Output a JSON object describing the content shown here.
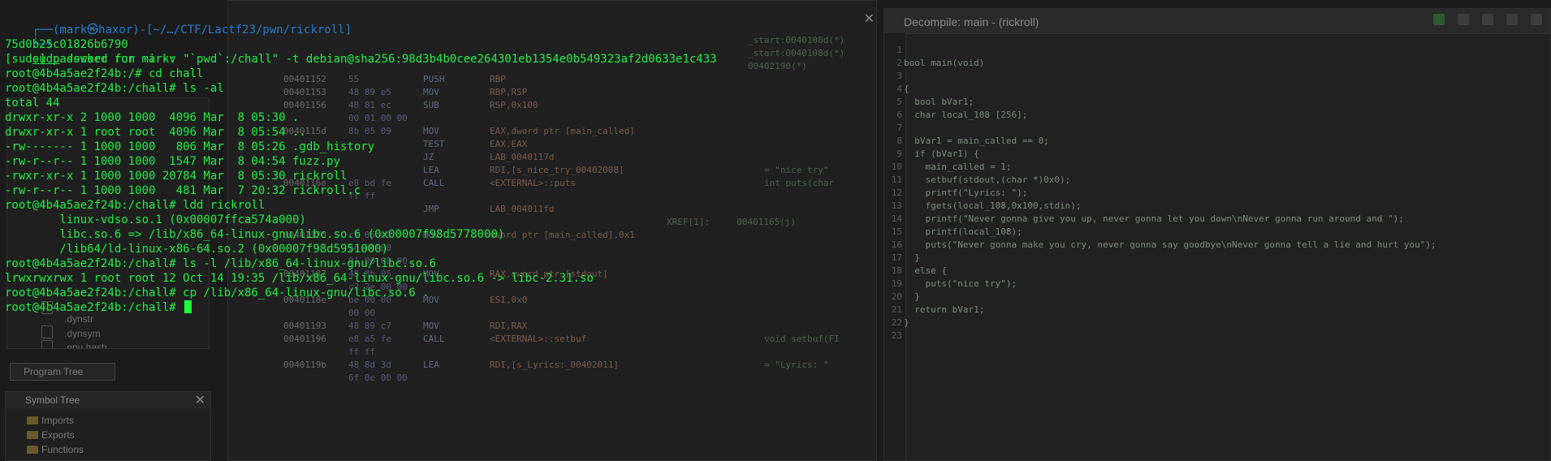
{
  "terminal": {
    "prompt_head": "┌──(mark㉿haxor)-[~/…/CTF/Lactf23/pwn/rickroll]",
    "prompt_tail": "└─$",
    "command_word": "sudo",
    "command_rest": " docker run -i -v \"`pwd`:/chall\" -t debian@sha256:98d3b4b0cee264301eb1354e0b549323af2d0633e1c433",
    "lines": [
      "75d0b25c01826b6790",
      "[sudo] password for mark:",
      "root@4b4a5ae2f24b:/# cd chall",
      "root@4b4a5ae2f24b:/chall# ls -al",
      "total 44",
      "drwxr-xr-x 2 1000 1000  4096 Mar  8 05:30 .",
      "drwxr-xr-x 1 root root  4096 Mar  8 05:54 ..",
      "-rw------- 1 1000 1000   806 Mar  8 05:26 .gdb_history",
      "-rw-r--r-- 1 1000 1000  1547 Mar  8 04:54 fuzz.py",
      "-rwxr-xr-x 1 1000 1000 20784 Mar  8 05:30 rickroll",
      "-rw-r--r-- 1 1000 1000   481 Mar  7 20:32 rickroll.c",
      "root@4b4a5ae2f24b:/chall# ldd rickroll",
      "        linux-vdso.so.1 (0x00007ffca574a000)",
      "        libc.so.6 => /lib/x86_64-linux-gnu/libc.so.6 (0x00007f98d5778000)",
      "        /lib64/ld-linux-x86-64.so.2 (0x00007f98d5951000)",
      "root@4b4a5ae2f24b:/chall# ls -l /lib/x86_64-linux-gnu/libc.so.6",
      "lrwxrwxrwx 1 root root 12 Oct 14 19:35 /lib/x86_64-linux-gnu/libc.so.6 -> libc-2.31.so",
      "root@4b4a5ae2f24b:/chall# cp /lib/x86_64-linux-gnu/libc.so.6 .",
      "root@4b4a5ae2f24b:/chall# "
    ]
  },
  "ghidra": {
    "decompile_title": "Decompile: main - (rickroll)",
    "line_numbers": [
      "1",
      "2",
      "3",
      "4",
      "5",
      "6",
      "7",
      "8",
      "9",
      "10",
      "11",
      "12",
      "13",
      "14",
      "15",
      "16",
      "17",
      "18",
      "19",
      "20",
      "21",
      "22",
      "23"
    ],
    "code_lines": [
      "",
      "bool main(void)",
      "",
      "{",
      "  bool bVar1;",
      "  char local_108 [256];",
      "",
      "  bVar1 = main_called == 0;",
      "  if (bVar1) {",
      "    main_called = 1;",
      "    setbuf(stdout,(char *)0x0);",
      "    printf(\"Lyrics: \");",
      "    fgets(local_108,0x100,stdin);",
      "    printf(\"Never gonna give you up, never gonna let you down\\nNever gonna run around and \");",
      "    printf(local_108);",
      "    puts(\"Never gonna make you cry, never gonna say goodbye\\nNever gonna tell a lie and hurt you\");",
      "  }",
      "  else {",
      "    puts(\"nice try\");",
      "  }",
      "  return bVar1;",
      "}",
      ""
    ],
    "xrefs": [
      "_start:0040108d(*)",
      "_start:0040108d(*)",
      "00402190(*)"
    ],
    "listing": [
      {
        "addr": "00401152",
        "bytes": "55",
        "mn": "PUSH",
        "op": "RBP",
        "com": ""
      },
      {
        "addr": "00401153",
        "bytes": "48 89 e5",
        "mn": "MOV",
        "op": "RBP,RSP",
        "com": ""
      },
      {
        "addr": "00401156",
        "bytes": "48 81 ec",
        "mn": "SUB",
        "op": "RSP,0x100",
        "com": ""
      },
      {
        "addr": "",
        "bytes": "00 01 00 00",
        "mn": "",
        "op": "",
        "com": ""
      },
      {
        "addr": "0040115d",
        "bytes": "8b 05 09",
        "mn": "MOV",
        "op": "EAX,dword ptr [main_called]",
        "com": ""
      },
      {
        "addr": "",
        "bytes": "",
        "mn": "TEST",
        "op": "EAX,EAX",
        "com": ""
      },
      {
        "addr": "",
        "bytes": "",
        "mn": "JZ",
        "op": "LAB_0040117d",
        "com": ""
      },
      {
        "addr": "",
        "bytes": "",
        "mn": "LEA",
        "op": "RDI,[s_nice_try_00402008]",
        "com": "= \"nice try\""
      },
      {
        "addr": "0040116e",
        "bytes": "e8 bd fe",
        "mn": "CALL",
        "op": "<EXTERNAL>::puts",
        "com": "int puts(char"
      },
      {
        "addr": "",
        "bytes": "ff ff",
        "mn": "",
        "op": "",
        "com": ""
      },
      {
        "addr": "",
        "bytes": "",
        "mn": "JMP",
        "op": "LAB_004011fd",
        "com": ""
      },
      {
        "addr": "",
        "bytes": "",
        "mn": "",
        "op": "",
        "com": "XREF[1]:     00401165(j)"
      },
      {
        "addr": "0040117d",
        "bytes": "c7 05 e5",
        "mn": "MOV",
        "op": "dword ptr [main_called],0x1",
        "com": ""
      },
      {
        "addr": "",
        "bytes": "2e 00 00",
        "mn": "",
        "op": "",
        "com": ""
      },
      {
        "addr": "",
        "bytes": "01 00 00 00",
        "mn": "",
        "op": "",
        "com": ""
      },
      {
        "addr": "00401187",
        "bytes": "48 8b 05",
        "mn": "MOV",
        "op": "RAX,qword ptr [stdout]",
        "com": ""
      },
      {
        "addr": "",
        "bytes": "c2 2e 00 00",
        "mn": "",
        "op": "",
        "com": ""
      },
      {
        "addr": "0040118e",
        "bytes": "be 00 00",
        "mn": "MOV",
        "op": "ESI,0x0",
        "com": ""
      },
      {
        "addr": "",
        "bytes": "00 00",
        "mn": "",
        "op": "",
        "com": ""
      },
      {
        "addr": "00401193",
        "bytes": "48 89 c7",
        "mn": "MOV",
        "op": "RDI,RAX",
        "com": ""
      },
      {
        "addr": "00401196",
        "bytes": "e8 a5 fe",
        "mn": "CALL",
        "op": "<EXTERNAL>::setbuf",
        "com": "void setbuf(FI"
      },
      {
        "addr": "",
        "bytes": "ff ff",
        "mn": "",
        "op": "",
        "com": ""
      },
      {
        "addr": "0040119b",
        "bytes": "48 8d 3d",
        "mn": "LEA",
        "op": "RDI,[s_Lyrics:_00402011]",
        "com": "= \"Lyrics: \""
      },
      {
        "addr": "",
        "bytes": "6f 0e 00 00",
        "mn": "",
        "op": "",
        "com": ""
      }
    ],
    "program_tree": {
      "tab_label": "Program Tree",
      "items": [
        ".dynstr",
        ".dynsym",
        ".gnu.hash"
      ]
    },
    "symbol_tree": {
      "title": "Symbol Tree",
      "items": [
        "Imports",
        "Exports",
        "Functions"
      ]
    }
  },
  "colors": {
    "terminal_green": "#27e84a",
    "prompt_blue": "#2f74d0"
  }
}
